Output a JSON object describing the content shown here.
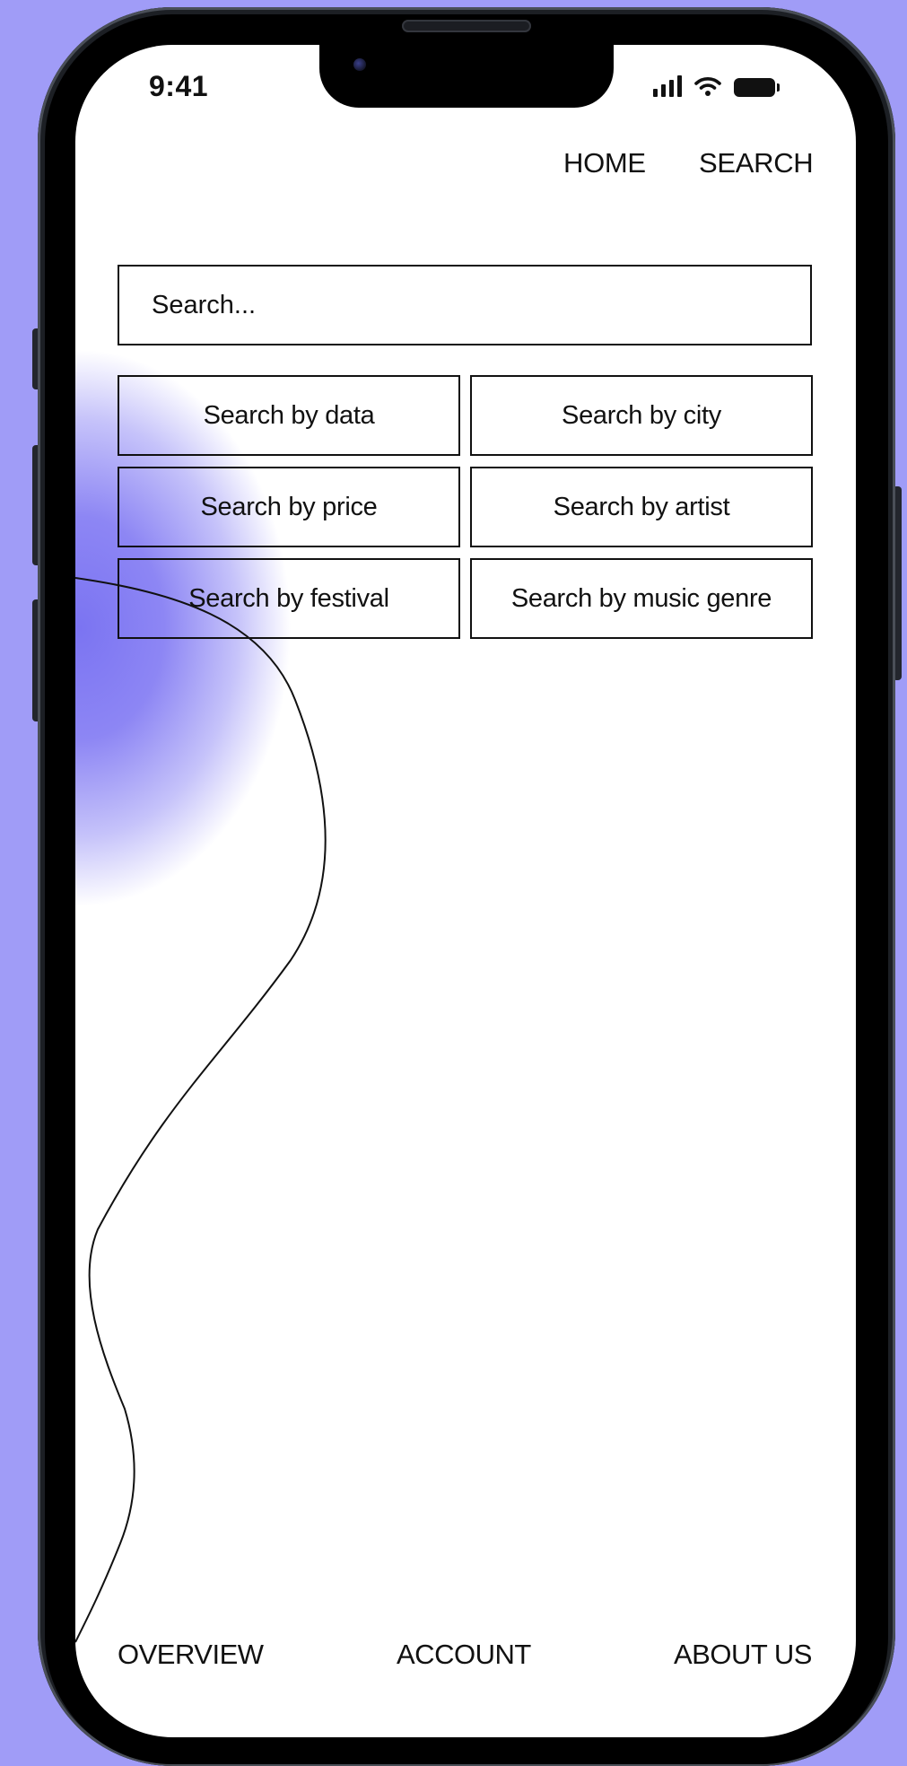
{
  "status_bar": {
    "time": "9:41",
    "icons": [
      "cellular-signal-icon",
      "wifi-icon",
      "battery-icon"
    ]
  },
  "top_nav": {
    "home": "HOME",
    "search": "SEARCH"
  },
  "search": {
    "placeholder": "Search..."
  },
  "filters": [
    "Search by data",
    "Search by city",
    "Search by price",
    "Search by artist",
    "Search by festival",
    "Search by music genre"
  ],
  "bottom_nav": {
    "overview": "OVERVIEW",
    "account": "ACCOUNT",
    "about": "ABOUT US"
  },
  "colors": {
    "background": "#a09cf7",
    "accent_blob": "#7b74f2",
    "text": "#111111",
    "screen": "#ffffff"
  }
}
